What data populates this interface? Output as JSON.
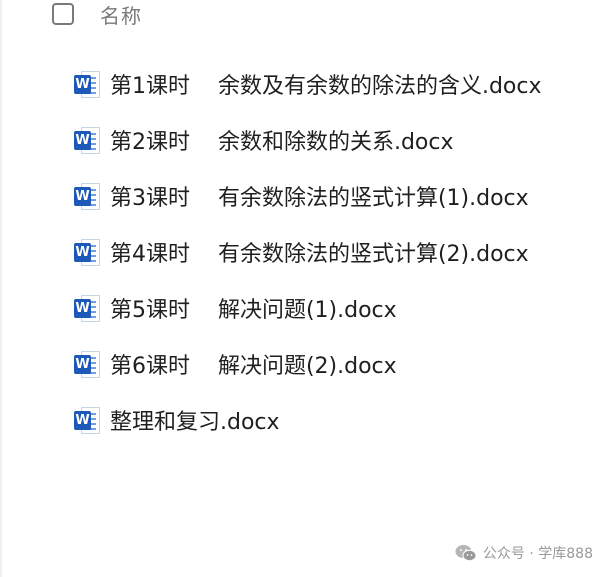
{
  "header": {
    "column_name": "名称"
  },
  "files": [
    {
      "name": "第1课时    余数及有余数的除法的含义.docx",
      "icon": "word-doc-icon"
    },
    {
      "name": "第2课时    余数和除数的关系.docx",
      "icon": "word-doc-icon"
    },
    {
      "name": "第3课时    有余数除法的竖式计算(1).docx",
      "icon": "word-doc-icon"
    },
    {
      "name": "第4课时    有余数除法的竖式计算(2).docx",
      "icon": "word-doc-icon"
    },
    {
      "name": "第5课时    解决问题(1).docx",
      "icon": "word-doc-icon"
    },
    {
      "name": "第6课时    解决问题(2).docx",
      "icon": "word-doc-icon"
    },
    {
      "name": "整理和复习.docx",
      "icon": "word-doc-icon"
    }
  ],
  "icon_badge_letter": "W",
  "watermark": {
    "text": "公众号 · 学库888",
    "icon": "wechat-icon"
  },
  "colors": {
    "word_blue": "#1e59b8",
    "header_gray": "#7a7a7a",
    "text": "#1f1f1f"
  }
}
